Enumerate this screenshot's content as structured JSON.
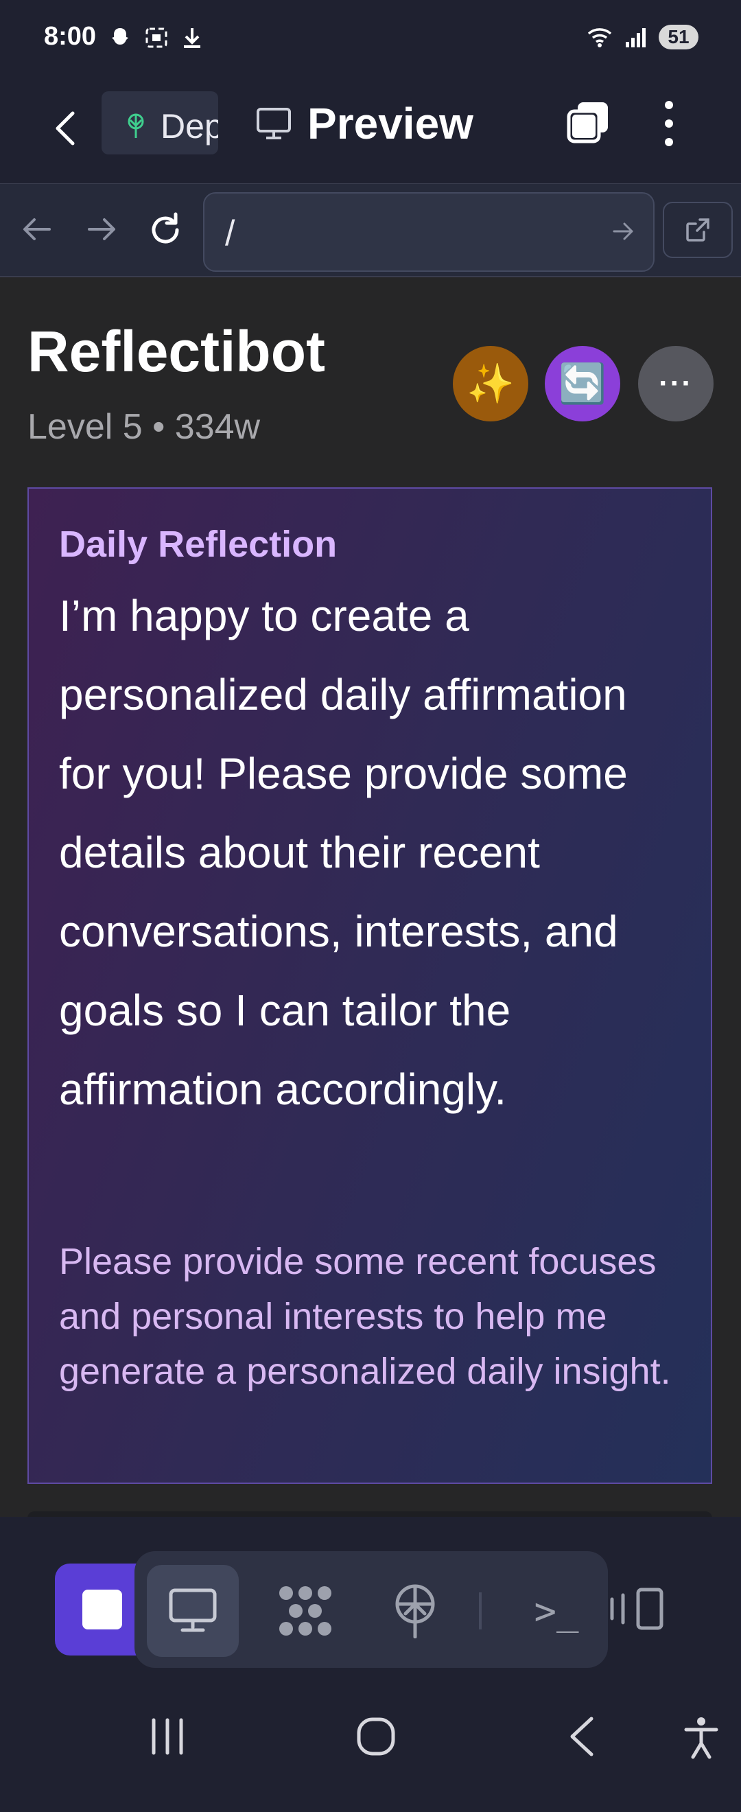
{
  "status": {
    "time": "8:00",
    "battery": "51"
  },
  "topbar": {
    "dep_tab_label": "Deployments",
    "title": "Preview"
  },
  "urlbar": {
    "url": "/"
  },
  "app": {
    "name": "Reflectibot",
    "subtitle": "Level 5 • 334w",
    "actions": {
      "sparkle": "✨",
      "refresh": "🔄",
      "more": "···"
    }
  },
  "card": {
    "label": "Daily Reflection",
    "body": "I’m happy to create a personalized daily affirmation for you! Please provide some details about their recent conversations, interests, and goals so I can tailor the affirmation accordingly.",
    "note": "Please provide some recent focuses and personal interests to help me generate a personalized daily insight."
  },
  "dock": {
    "terminal_glyph": ">_"
  },
  "colors": {
    "accent": "#5a3ed6",
    "card_label": "#d9b6ff",
    "card_note": "#d8b8f2"
  }
}
